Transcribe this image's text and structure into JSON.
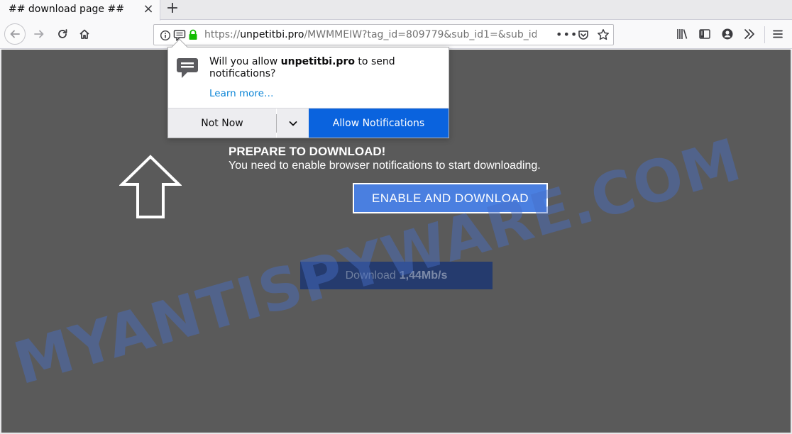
{
  "tab": {
    "title": "## download page ##",
    "close_glyph": "×",
    "new_tab_glyph": "+"
  },
  "urlbar": {
    "scheme": "https://",
    "host": "unpetitbi.pro",
    "path": "/MWMMEIW?tag_id=809779&sub_id1=&sub_id2=",
    "more_glyph": "•••"
  },
  "icons": {
    "back": "back-arrow-icon",
    "forward": "forward-arrow-icon",
    "reload": "reload-icon",
    "home": "home-icon",
    "site_info": "info-icon",
    "notification_permission": "notification-icon",
    "secure": "lock-icon",
    "pocket": "pocket-icon",
    "bookmark": "star-icon",
    "library": "library-icon",
    "sidebar": "sidebar-icon",
    "account": "account-icon",
    "overflow": "chevrons-right-icon",
    "menu": "hamburger-menu-icon"
  },
  "doorhanger": {
    "message_prefix": "Will you allow ",
    "message_host": "unpetitbi.pro",
    "message_suffix": " to send notifications?",
    "learn_more": "Learn more…",
    "not_now_label": "Not Now",
    "allow_label": "Allow Notifications"
  },
  "page": {
    "prepare_title": "PREPARE TO DOWNLOAD!",
    "prepare_subtitle": "You need to enable browser notifications to start downloading.",
    "enable_button": "ENABLE AND DOWNLOAD",
    "download_label": "Download",
    "download_speed": "1,44Mb/s",
    "watermark": "MYANTISPYWARE.COM"
  },
  "colors": {
    "page_background": "#5a5a5a",
    "allow_button": "#0a63de",
    "enable_button": "#4a7fe0",
    "download_button": "#253b6e",
    "secure_lock": "#12bc00",
    "link": "#0a84d6"
  }
}
